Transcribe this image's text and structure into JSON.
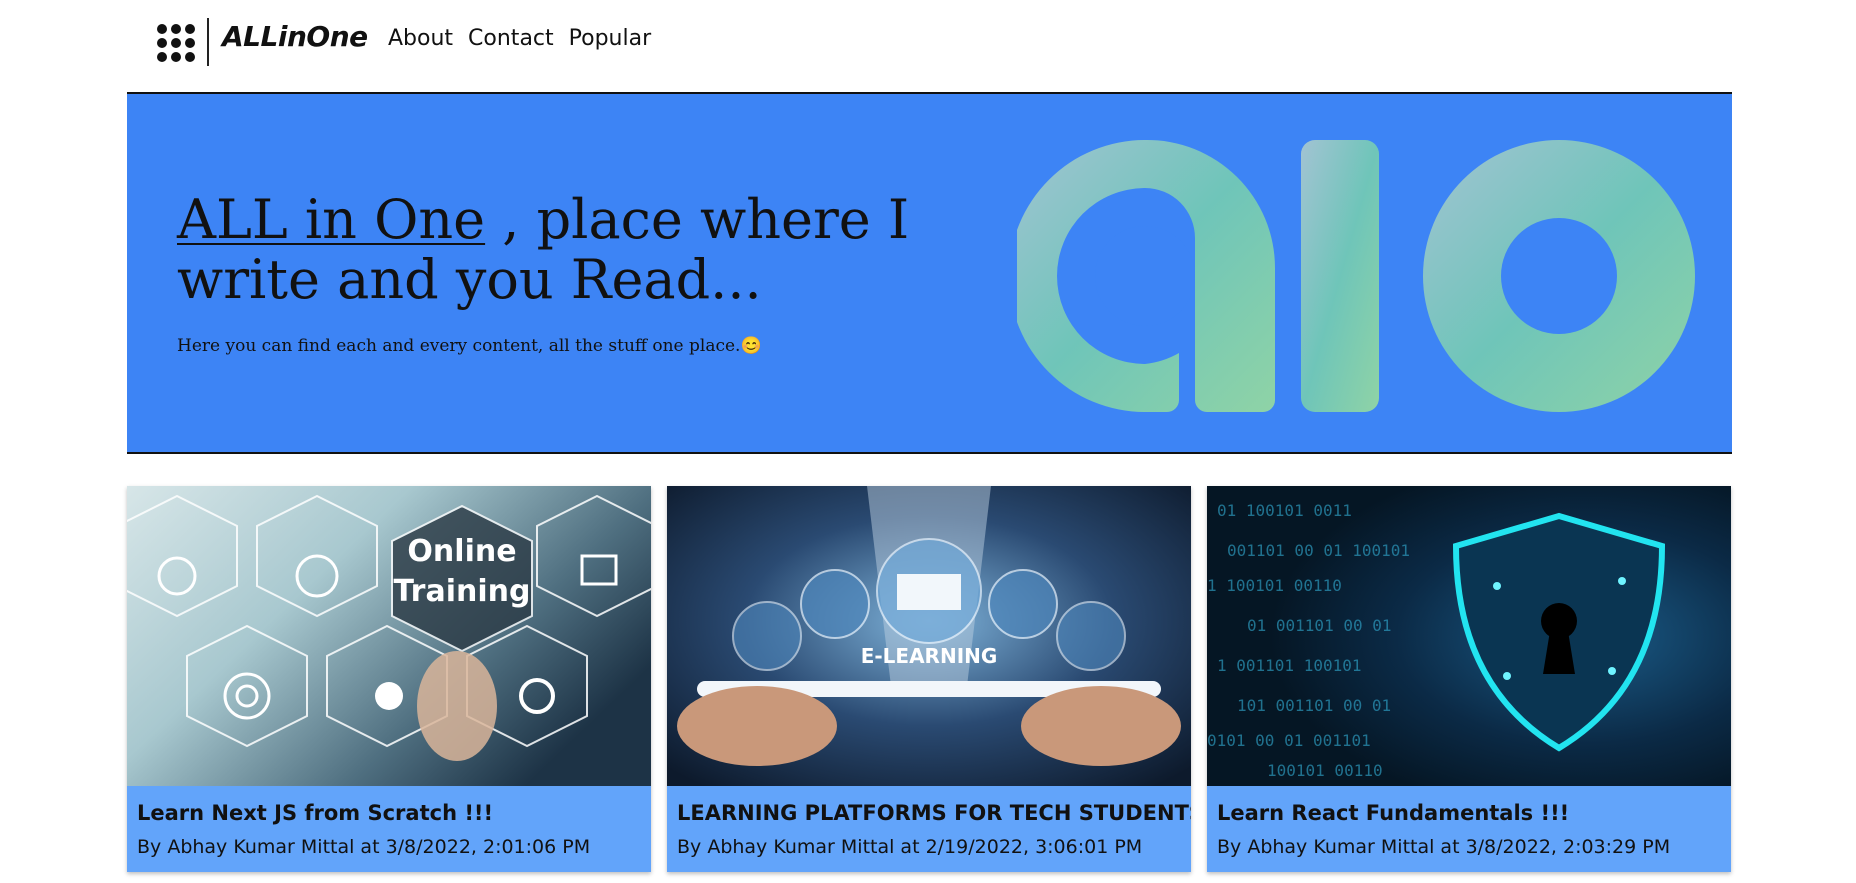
{
  "nav": {
    "brand": "ALLinOne",
    "links": [
      "About",
      "Contact",
      "Popular"
    ]
  },
  "hero": {
    "title_link": "ALL in One",
    "title_rest": " , place where I write and you Read...",
    "subtitle": "Here you can find each and every content, all the stuff one place.😊",
    "logo_text": "alo"
  },
  "cards": [
    {
      "title": "Learn Next JS from Scratch !!!",
      "meta": "By Abhay Kumar Mittal at 3/8/2022, 2:01:06 PM",
      "image_text_1": "Online",
      "image_text_2": "Training"
    },
    {
      "title": "LEARNING PLATFORMS FOR TECH STUDENTS",
      "meta": "By Abhay Kumar Mittal at 2/19/2022, 3:06:01 PM",
      "image_text_1": "E-LEARNING"
    },
    {
      "title": "Learn React Fundamentals !!!",
      "meta": "By Abhay Kumar Mittal at 3/8/2022, 2:03:29 PM"
    }
  ],
  "colors": {
    "hero_bg": "#3d84f5",
    "card_bg": "#62a4fa",
    "logo_gradient_start": "#9ec3d6",
    "logo_gradient_end": "#7fd0a8"
  }
}
